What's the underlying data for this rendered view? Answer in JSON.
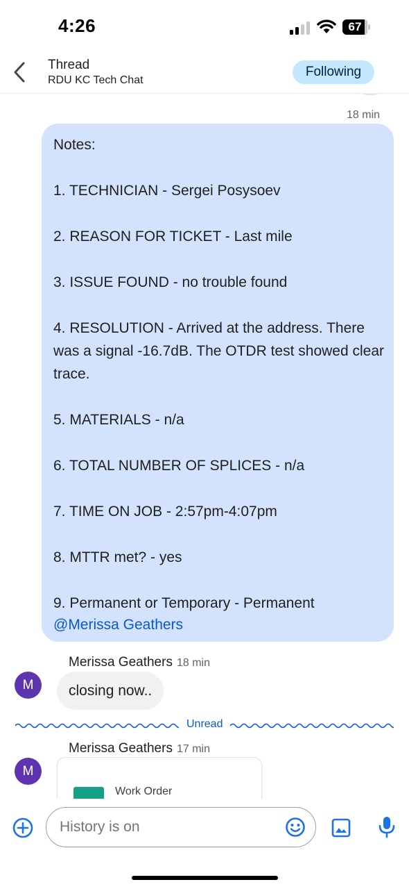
{
  "status_bar": {
    "time": "4:26",
    "battery": "67"
  },
  "header": {
    "title": "Thread",
    "subtitle": "RDU KC Tech Chat",
    "follow_label": "Following"
  },
  "notes_message": {
    "time": "18 min",
    "lines": [
      "Notes:",
      "",
      "1. TECHNICIAN - Sergei Posysoev",
      "",
      "2. REASON FOR TICKET - Last mile",
      "",
      "3. ISSUE FOUND - no trouble found",
      "",
      "4. RESOLUTION - Arrived at the address. There was a signal -16.7dB. The OTDR test showed clear trace.",
      "",
      "5. MATERIALS - n/a",
      "",
      "6. TOTAL NUMBER OF SPLICES - n/a",
      "",
      "7. TIME ON JOB - 2:57pm-4:07pm",
      "",
      "8. MTTR met? - yes",
      "",
      "9. Permanent or Temporary - Permanent"
    ],
    "mention": "@Merissa Geathers"
  },
  "reply_message": {
    "avatar_initial": "M",
    "sender": "Merissa Geathers",
    "time": "18 min",
    "text": "closing now.."
  },
  "unread_label": "Unread",
  "card_message": {
    "avatar_initial": "M",
    "sender": "Merissa Geathers",
    "time": "17 min",
    "card_title": "Work Order"
  },
  "composer": {
    "placeholder": "History is on",
    "accent_color": "#1a73e8"
  },
  "colors": {
    "notes_bubble": "#d3e3fd",
    "following_pill": "#c2e7ff",
    "avatar": "#5e35b1",
    "mention": "#0b57d0"
  }
}
